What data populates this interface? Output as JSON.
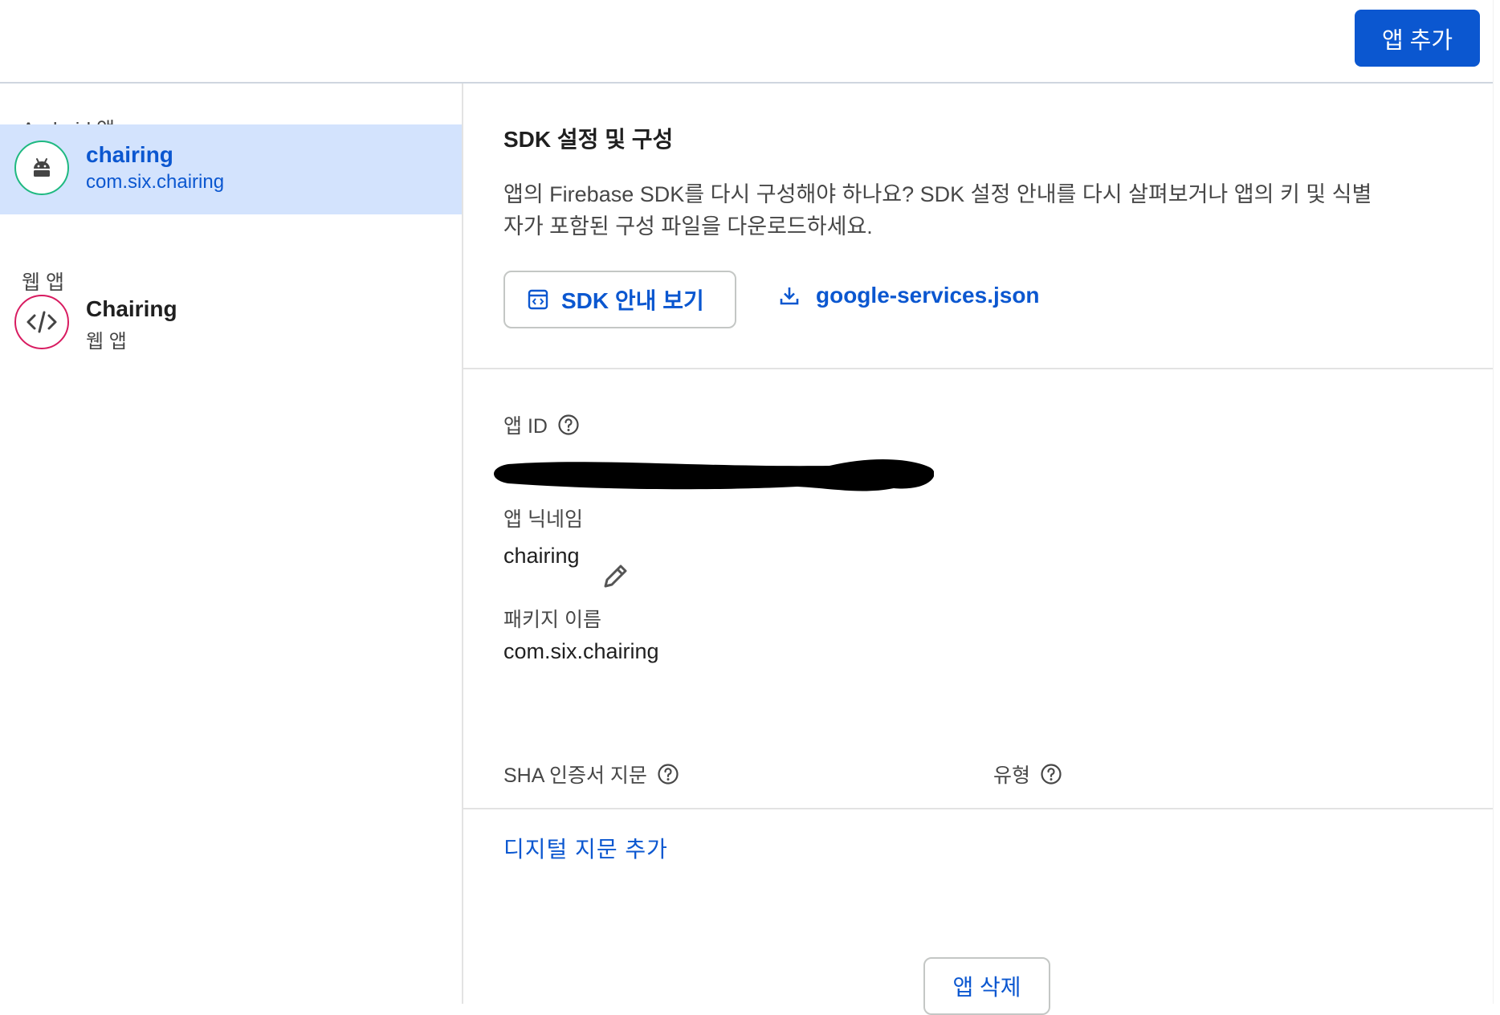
{
  "header": {
    "add_app_label": "앱 추가"
  },
  "sidebar": {
    "android_section_label": "Android 앱",
    "web_section_label": "웹 앱",
    "android_apps": [
      {
        "name": "chairing",
        "subtitle": "com.six.chairing",
        "icon": "android-icon",
        "selected": true
      }
    ],
    "web_apps": [
      {
        "name": "Chairing",
        "subtitle": "웹 앱",
        "icon": "code-icon",
        "selected": false
      }
    ]
  },
  "main": {
    "sdk_section": {
      "title": "SDK 설정 및 구성",
      "description_line1": "앱의 Firebase SDK를 다시 구성해야 하나요? SDK 설정 안내를 다시 살펴보거나 앱의 키 및 식별",
      "description_line2": "자가 포함된 구성 파일을 다운로드하세요.",
      "guide_button_label": "SDK 안내 보기",
      "download_label": "google-services.json"
    },
    "app_id_label": "앱 ID",
    "nickname_label": "앱 닉네임",
    "nickname_value": "chairing",
    "package_label": "패키지 이름",
    "package_value": "com.six.chairing",
    "sha_label": "SHA 인증서 지문",
    "type_label": "유형",
    "add_fingerprint_label": "디지털 지문 추가",
    "delete_app_label": "앱 삭제"
  },
  "colors": {
    "accent": "#0b57d0",
    "selected_bg": "#d3e3fd",
    "android_ring": "#1eb980",
    "web_ring": "#d81b60"
  }
}
